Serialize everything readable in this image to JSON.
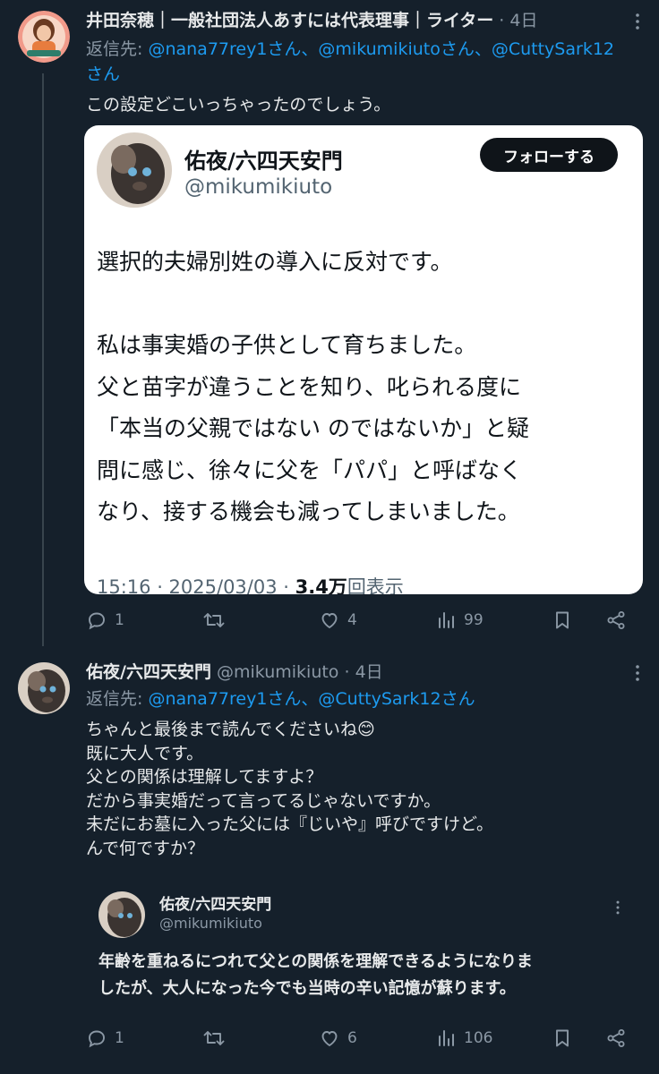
{
  "post1": {
    "author": "井田奈穂｜一般社団法人あすには代表理事｜ライター",
    "time_sep": "·",
    "time": "4日",
    "reply_prefix": "返信先: ",
    "reply_to_1": "@nana77rey1さん、@mikumikiutoさん、@CuttySark12",
    "reply_to_2": "さん",
    "text": "この設定どこいっちゃったのでしょう。",
    "embedded": {
      "name": "佑夜/六四天安門",
      "handle": "@mikumikiuto",
      "follow_label": "フォローする",
      "lines": [
        "選択的夫婦別姓の導入に反対です。",
        "",
        "私は事実婚の子供として育ちました。",
        "父と苗字が違うことを知り、叱られる度に",
        "「本当の父親ではない のではないか」と疑",
        "問に感じ、徐々に父を「パパ」と呼ばなく",
        "なり、接する機会も減ってしまいました。"
      ],
      "meta_time": "15:16 · 2025/03/03 · ",
      "meta_views": "3.4万",
      "meta_views_label": "回表示"
    },
    "actions": {
      "replies": "1",
      "retweets": "",
      "likes": "4",
      "views": "99"
    }
  },
  "post2": {
    "author": "佑夜/六四天安門",
    "handle": "@mikumikiuto",
    "time_sep": "·",
    "time": "4日",
    "reply_prefix": "返信先: ",
    "reply_to": "@nana77rey1さん、@CuttySark12さん",
    "lines": [
      "ちゃんと最後まで読んでくださいね😊",
      "既に大人です。",
      "父との関係は理解してますよ？",
      "だから事実婚だって言ってるじゃないですか。",
      "未だにお墓に入った父には『じいや』呼びですけど。",
      "んで何ですか？"
    ],
    "quote": {
      "name": "佑夜/六四天安門",
      "handle": "@mikumikiuto",
      "lines": [
        "年齢を重ねるにつれて父との関係を理解できるようになりま",
        "したが、大人になった今でも当時の辛い記憶が蘇ります。"
      ]
    },
    "actions": {
      "replies": "1",
      "retweets": "",
      "likes": "6",
      "views": "106"
    }
  },
  "icons": [
    "reply-icon",
    "retweet-icon",
    "like-icon",
    "views-icon",
    "bookmark-icon",
    "share-icon",
    "more-icon"
  ]
}
